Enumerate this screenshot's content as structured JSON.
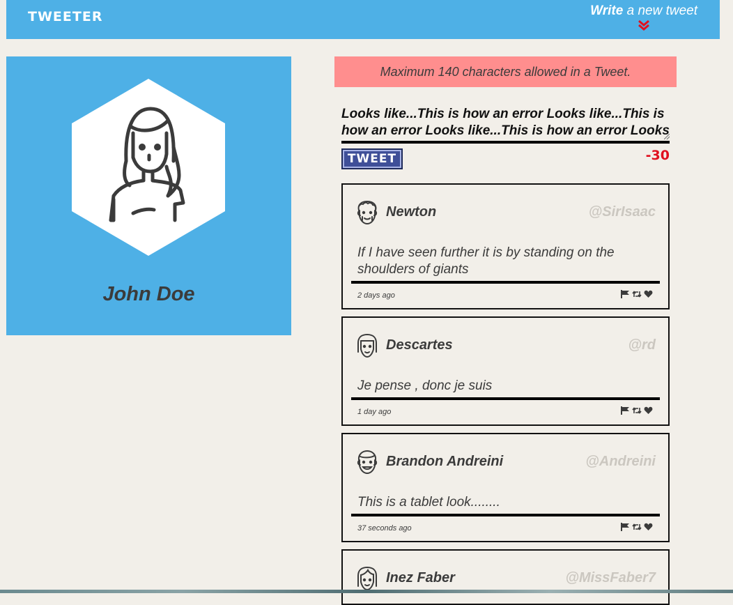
{
  "nav": {
    "brand": "TWEETER",
    "compose_bold": "Write",
    "compose_rest": " a new tweet",
    "compose_icon": "double-chevron-down-icon",
    "chevron_color": "#e0101f"
  },
  "profile": {
    "name": "John Doe",
    "avatar_icon": "girl-avatar-icon",
    "background": "#4eb0e6"
  },
  "composer": {
    "error_message": "Maximum 140 characters allowed in a Tweet.",
    "text": "Looks like...This is how an error Looks like...This is how an error Looks like...This is how an error Looks like...",
    "button_label": "TWEET",
    "counter": "-30",
    "counter_color": "#e0101f"
  },
  "tweets": [
    {
      "name": "Newton",
      "handle": "@SirIsaac",
      "text": "If I have seen further it is by standing on the shoulders of giants",
      "time": "2 days ago",
      "avatar_icon": "curly-hair-man-avatar-icon"
    },
    {
      "name": "Descartes",
      "handle": "@rd",
      "text": "Je pense , donc je suis",
      "time": "1 day ago",
      "avatar_icon": "bob-hair-avatar-icon"
    },
    {
      "name": "Brandon Andreini",
      "handle": "@Andreini",
      "text": "This is a tablet look........",
      "time": "37 seconds ago",
      "avatar_icon": "smiling-man-avatar-icon"
    },
    {
      "name": "Inez Faber",
      "handle": "@MissFaber7",
      "avatar_icon": "woman-avatar-icon"
    }
  ],
  "tweet_actions": [
    "flag-icon",
    "retweet-icon",
    "heart-icon"
  ]
}
